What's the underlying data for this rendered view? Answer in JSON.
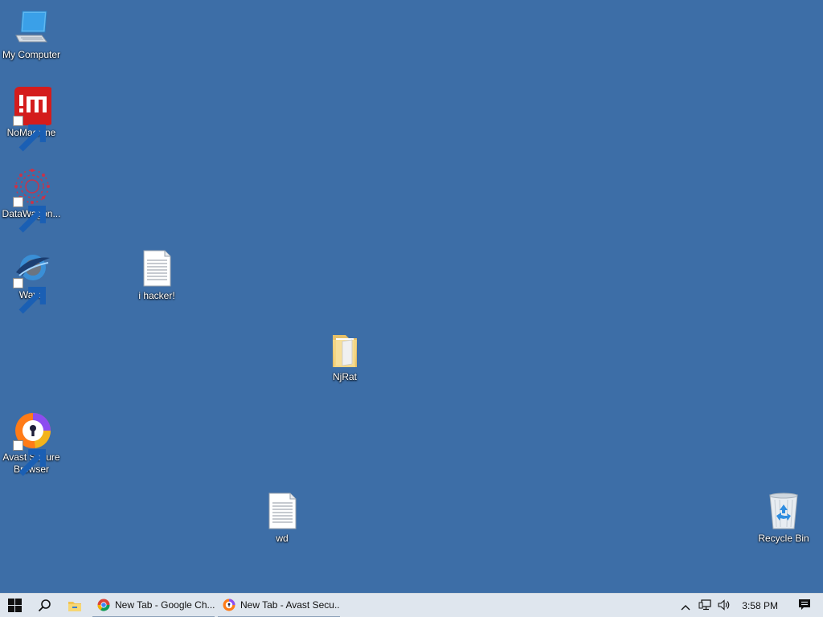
{
  "desktop": {
    "icons": [
      {
        "label": "My Computer",
        "icon": "computer-icon"
      },
      {
        "label": "NoMachine",
        "icon": "nomachine-icon"
      },
      {
        "label": "DataWagon...",
        "icon": "datawagon-icon"
      },
      {
        "label": "Wave",
        "icon": "wave-icon"
      },
      {
        "label": "i hacker!",
        "icon": "text-file-icon"
      },
      {
        "label": "NjRat",
        "icon": "folder-icon"
      },
      {
        "label": "Avast Secure Browser",
        "icon": "avast-browser-icon"
      },
      {
        "label": "wd",
        "icon": "text-file-icon"
      },
      {
        "label": "Recycle Bin",
        "icon": "recycle-bin-icon"
      }
    ]
  },
  "taskbar": {
    "start_icon": "windows-start-icon",
    "search_icon": "search-icon",
    "explorer_icon": "file-explorer-icon",
    "apps": [
      {
        "label": "New Tab - Google Ch...",
        "icon": "chrome-icon"
      },
      {
        "label": "New Tab - Avast Secu...",
        "icon": "avast-browser-icon"
      }
    ],
    "tray": {
      "chevron_icon": "chevron-up-icon",
      "network_icon": "network-icon",
      "volume_icon": "volume-icon",
      "time": "3:58 PM",
      "notifications_icon": "action-center-icon"
    }
  },
  "colors": {
    "desktop_background": "#3d6ea7",
    "taskbar_background": "#dfe6ee"
  }
}
